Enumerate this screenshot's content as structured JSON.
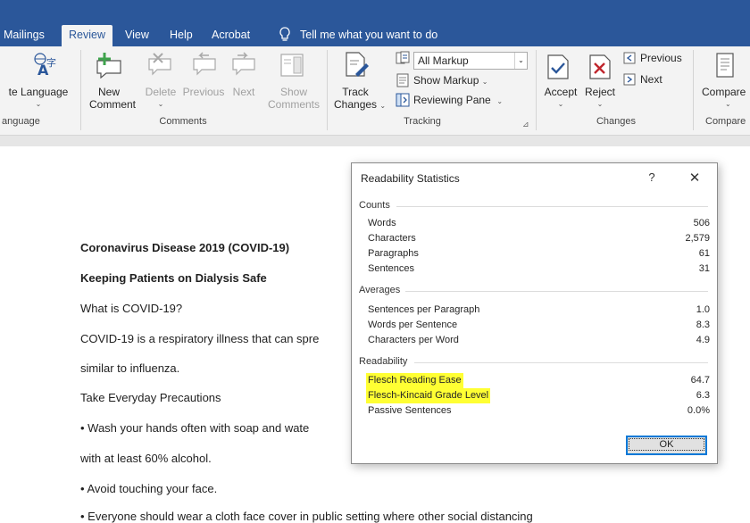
{
  "tabs": [
    {
      "label": "Mailings",
      "active": false
    },
    {
      "label": "Review",
      "active": true
    },
    {
      "label": "View",
      "active": false
    },
    {
      "label": "Help",
      "active": false
    },
    {
      "label": "Acrobat",
      "active": false
    }
  ],
  "tell_me": "Tell me what you want to do",
  "ribbon": {
    "language": {
      "button": "te Language",
      "group": "anguage"
    },
    "comments": {
      "new": [
        "New",
        "Comment"
      ],
      "delete": "Delete",
      "previous": "Previous",
      "next": "Next",
      "show": [
        "Show",
        "Comments"
      ],
      "group": "Comments"
    },
    "tracking": {
      "track_changes": [
        "Track",
        "Changes"
      ],
      "markup_selected": "All Markup",
      "show_markup": "Show Markup",
      "reviewing_pane": "Reviewing Pane",
      "group": "Tracking"
    },
    "changes": {
      "accept": "Accept",
      "reject": "Reject",
      "previous": "Previous",
      "next": "Next",
      "group": "Changes"
    },
    "compare": {
      "button": "Compare",
      "group": "Compare"
    }
  },
  "document": {
    "lines": [
      {
        "text": "Coronavirus Disease 2019 (COVID-19)",
        "bold": true
      },
      {
        "text": "Keeping Patients on Dialysis Safe",
        "bold": true
      },
      {
        "text": "What is COVID-19?",
        "bold": false
      },
      {
        "text": "COVID-19 is a respiratory illness that can spre",
        "bold": false
      },
      {
        "text": "similar to influenza.",
        "bold": false
      },
      {
        "text": "Take Everyday Precautions",
        "bold": false
      },
      {
        "text": "• Wash your hands often with soap and wate",
        "bold": false
      },
      {
        "text": "with at least 60% alcohol.",
        "bold": false
      },
      {
        "text": "• Avoid touching your face.",
        "bold": false
      },
      {
        "text": "• Everyone should wear a cloth face cover in public setting where other social distancing",
        "bold": false
      }
    ]
  },
  "dialog": {
    "title": "Readability Statistics",
    "help": "?",
    "close": "✕",
    "counts": {
      "heading": "Counts",
      "rows": [
        {
          "label": "Words",
          "value": "506"
        },
        {
          "label": "Characters",
          "value": "2,579"
        },
        {
          "label": "Paragraphs",
          "value": "61"
        },
        {
          "label": "Sentences",
          "value": "31"
        }
      ]
    },
    "averages": {
      "heading": "Averages",
      "rows": [
        {
          "label": "Sentences per Paragraph",
          "value": "1.0"
        },
        {
          "label": "Words per Sentence",
          "value": "8.3"
        },
        {
          "label": "Characters per Word",
          "value": "4.9"
        }
      ]
    },
    "readability": {
      "heading": "Readability",
      "rows": [
        {
          "label": "Flesch Reading Ease",
          "value": "64.7",
          "highlighted": true
        },
        {
          "label": "Flesch-Kincaid Grade Level",
          "value": "6.3",
          "highlighted": true
        },
        {
          "label": "Passive Sentences",
          "value": "0.0%",
          "highlighted": false
        }
      ]
    },
    "ok": "OK"
  },
  "colors": {
    "tab_bar": "#2b579a",
    "ribbon_bg": "#f3f3f3",
    "highlight": "#ffff33",
    "accent": "#0078d7"
  }
}
